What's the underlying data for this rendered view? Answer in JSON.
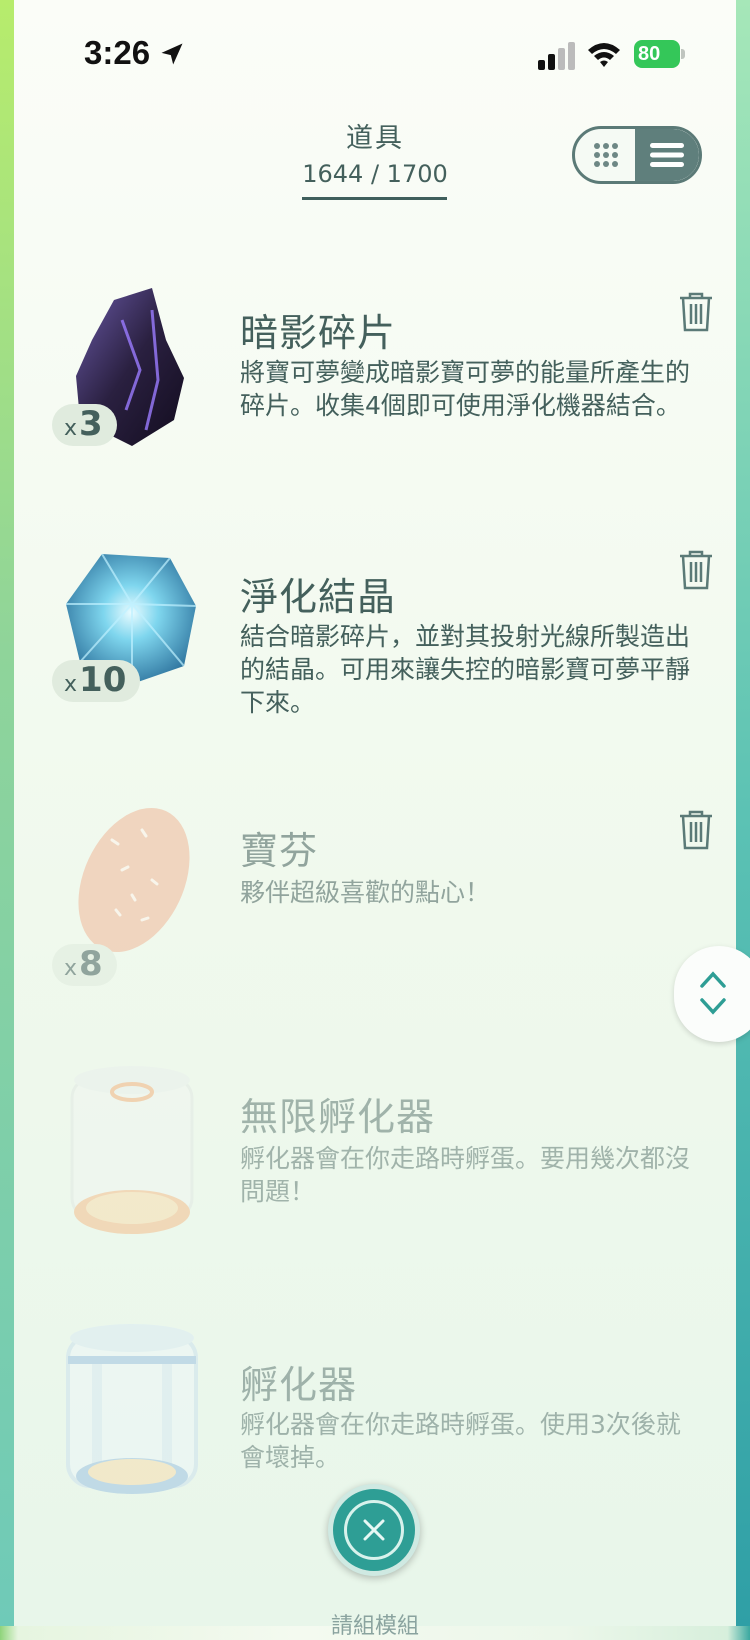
{
  "status_bar": {
    "time": "3:26",
    "battery": "80"
  },
  "header": {
    "title": "道具",
    "count": "1644 / 1700"
  },
  "items": [
    {
      "name": "暗影碎片",
      "description": "將寶可夢變成暗影寶可夢的能量所產生的碎片。收集4個即可使用淨化機器結合。",
      "qty_prefix": "x",
      "qty": "3",
      "icon": "shadow-shard-icon"
    },
    {
      "name": "淨化結晶",
      "description": "結合暗影碎片，並對其投射光線所製造出的結晶。可用來讓失控的暗影寶可夢平靜下來。",
      "qty_prefix": "x",
      "qty": "10",
      "icon": "purifying-crystal-icon"
    },
    {
      "name": "寶芬",
      "description": "夥伴超級喜歡的點心！",
      "qty_prefix": "x",
      "qty": "8",
      "icon": "poffin-icon"
    },
    {
      "name": "無限孵化器",
      "description": "孵化器會在你走路時孵蛋。要用幾次都沒問題！",
      "icon": "infinite-incubator-icon"
    },
    {
      "name": "孵化器",
      "description": "孵化器會在你走路時孵蛋。使用3次後就會壞掉。",
      "icon": "incubator-icon"
    }
  ],
  "bottom": {
    "label": "請組模組"
  },
  "colors": {
    "accent": "#2e9e95",
    "text": "#44605c",
    "battery": "#34c759"
  }
}
